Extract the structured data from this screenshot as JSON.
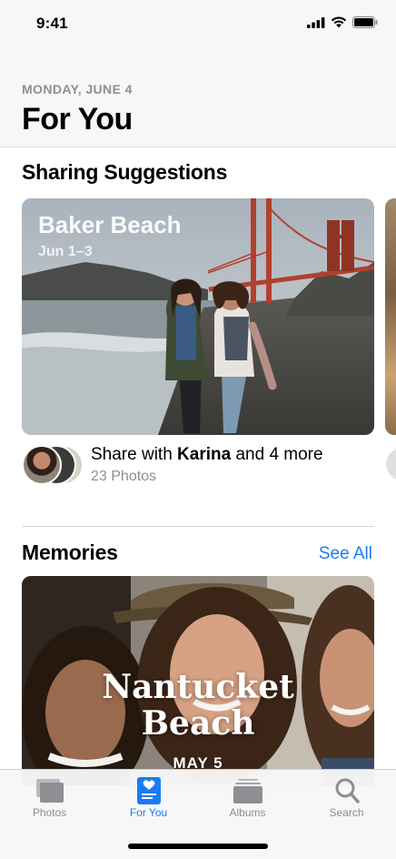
{
  "status_bar": {
    "time": "9:41"
  },
  "header": {
    "date": "MONDAY, JUNE 4",
    "title": "For You"
  },
  "sharing": {
    "heading": "Sharing Suggestions",
    "card": {
      "title": "Baker Beach",
      "date": "Jun 1–3"
    },
    "share_prefix": "Share with ",
    "share_name": "Karina",
    "share_suffix": " and 4 more",
    "photo_count": "23 Photos"
  },
  "memories": {
    "heading": "Memories",
    "see_all": "See All",
    "card": {
      "title_line1": "Nantucket",
      "title_line2": "Beach",
      "date": "MAY 5"
    }
  },
  "tabs": [
    {
      "label": "Photos",
      "icon": "photos-stack-icon",
      "active": false
    },
    {
      "label": "For You",
      "icon": "for-you-heart-icon",
      "active": true
    },
    {
      "label": "Albums",
      "icon": "albums-stack-icon",
      "active": false
    },
    {
      "label": "Search",
      "icon": "magnifier-icon",
      "active": false
    }
  ],
  "colors": {
    "accent": "#1a7cf4",
    "secondary_text": "#8e8e93",
    "bar_background": "#f7f7f7"
  }
}
